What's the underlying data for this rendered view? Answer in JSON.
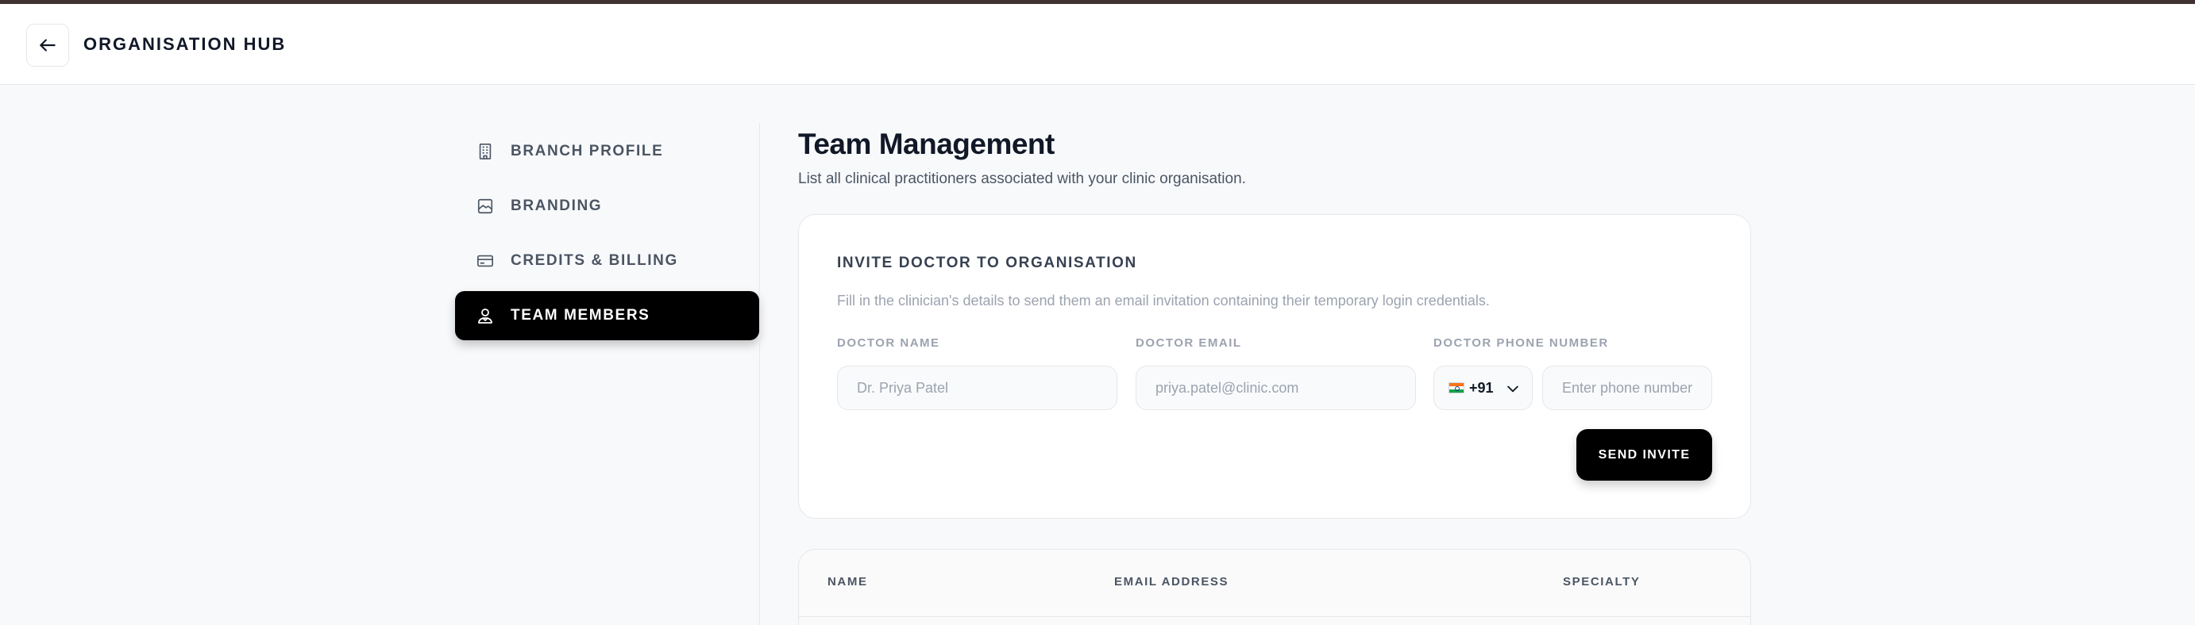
{
  "header": {
    "title": "ORGANISATION HUB",
    "back_icon": "arrow-left-icon"
  },
  "sidebar": {
    "items": [
      {
        "label": "BRANCH PROFILE",
        "icon": "building-icon",
        "active": false
      },
      {
        "label": "BRANDING",
        "icon": "image-icon",
        "active": false
      },
      {
        "label": "CREDITS & BILLING",
        "icon": "credit-card-icon",
        "active": false
      },
      {
        "label": "TEAM MEMBERS",
        "icon": "users-icon",
        "active": true
      }
    ]
  },
  "main": {
    "title": "Team Management",
    "subtitle": "List all clinical practitioners associated with your clinic organisation."
  },
  "invite": {
    "title": "INVITE DOCTOR TO ORGANISATION",
    "description": "Fill in the clinician's details to send them an email invitation containing their temporary login credentials.",
    "name_label": "DOCTOR NAME",
    "name_placeholder": "Dr. Priya Patel",
    "email_label": "DOCTOR EMAIL",
    "email_placeholder": "priya.patel@clinic.com",
    "phone_label": "DOCTOR PHONE NUMBER",
    "country_flag": "india-flag-icon",
    "country_code": "+91",
    "phone_placeholder": "Enter phone number",
    "send_label": "SEND INVITE"
  },
  "table": {
    "columns": [
      "NAME",
      "EMAIL ADDRESS",
      "SPECIALTY"
    ]
  },
  "colors": {
    "accent": "#000000",
    "top_strip": "#3f3230",
    "background": "#f8f9fb"
  }
}
